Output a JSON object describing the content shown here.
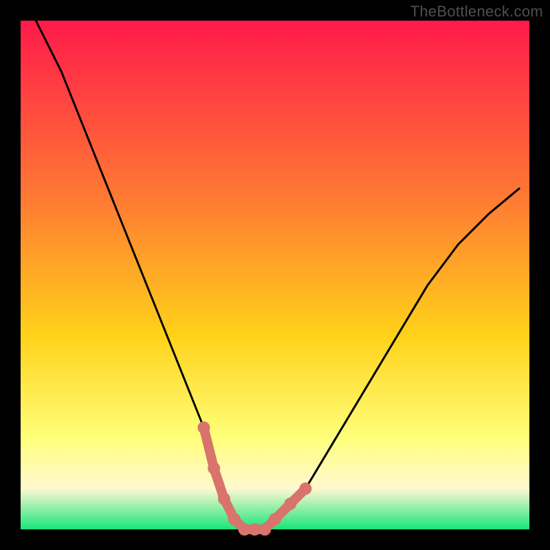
{
  "watermark": "TheBottleneck.com",
  "colors": {
    "gradient_top": "#ff1a4a",
    "gradient_mid1": "#ff7a33",
    "gradient_mid2": "#ffd21a",
    "gradient_low": "#ffff7a",
    "gradient_cream": "#fff8d0",
    "gradient_bottom": "#18e67a",
    "curve_stroke": "#000000",
    "highlight": "#d9746c",
    "border": "#000000"
  },
  "chart_data": {
    "type": "line",
    "title": "",
    "xlabel": "",
    "ylabel": "",
    "xlim": [
      0,
      100
    ],
    "ylim": [
      0,
      100
    ],
    "grid": false,
    "legend": false,
    "annotations": [
      "TheBottleneck.com"
    ],
    "series": [
      {
        "name": "bottleneck-curve",
        "x": [
          3,
          8,
          12,
          16,
          20,
          24,
          28,
          32,
          36,
          38,
          40,
          42,
          44,
          46,
          48,
          50,
          56,
          62,
          68,
          74,
          80,
          86,
          92,
          98
        ],
        "y": [
          100,
          90,
          80,
          70,
          60,
          50,
          40,
          30,
          20,
          12,
          6,
          2,
          0,
          0,
          0,
          2,
          8,
          18,
          28,
          38,
          48,
          56,
          62,
          67
        ]
      }
    ],
    "highlight_segments": [
      {
        "name": "left-wall",
        "x": [
          36,
          38,
          40,
          42
        ],
        "y": [
          20,
          12,
          6,
          2
        ]
      },
      {
        "name": "valley-floor",
        "x": [
          42,
          44,
          46,
          48
        ],
        "y": [
          2,
          0,
          0,
          0
        ]
      },
      {
        "name": "right-wall",
        "x": [
          48,
          50,
          53,
          56
        ],
        "y": [
          0,
          2,
          5,
          8
        ]
      }
    ]
  }
}
